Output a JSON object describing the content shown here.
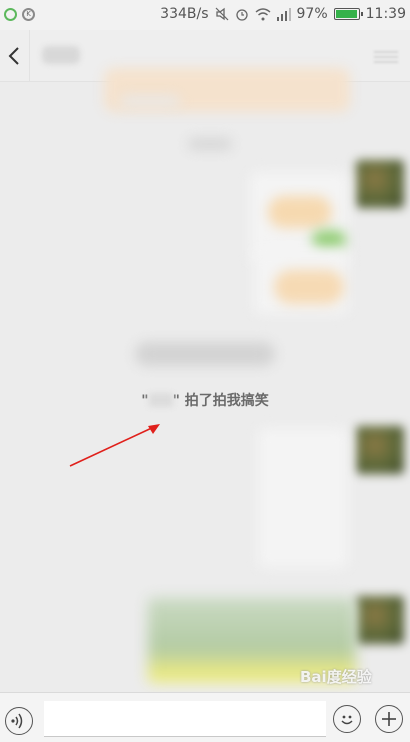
{
  "status_bar": {
    "network_speed": "334B/s",
    "battery_percent": "97%",
    "battery_level": 0.97,
    "time": "11:39",
    "icons": [
      "notification-circle-icon",
      "k-app-icon",
      "mute-icon",
      "alarm-icon",
      "wifi-icon",
      "signal-icon",
      "battery-icon"
    ],
    "battery_color": "#35b24a"
  },
  "header": {
    "back_icon": "chevron-left-icon",
    "more_icon": "more-menu-icon"
  },
  "chat": {
    "pat_notice": "\"  ”拍了拍我搞笑",
    "pat_notice_prefix": "\"",
    "pat_notice_suffix": "\" 拍了拍我搞笑"
  },
  "input_bar": {
    "voice_icon": "voice-icon",
    "input_value": "",
    "emoji_icon": "emoji-icon",
    "plus_icon": "plus-icon"
  },
  "watermark": "Bai度经验",
  "colors": {
    "background": "#ececec",
    "arrow": "#e0201b",
    "notice_text": "#6a6a6a"
  }
}
